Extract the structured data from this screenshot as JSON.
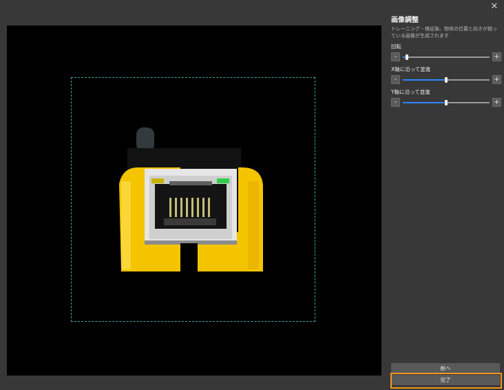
{
  "dialog": {
    "close_symbol": "✕",
    "close_icon": "close-icon"
  },
  "panel": {
    "title": "画像調整",
    "description": "トレーニング・検証後、物体の位置と向きが揃っている画像が生成されます"
  },
  "controls": [
    {
      "label": "回転",
      "minus": "-",
      "plus": "+",
      "value_fraction": 0.05,
      "accent": "#2f87ff"
    },
    {
      "label": "X軸に沿って並進",
      "minus": "-",
      "plus": "+",
      "value_fraction": 0.5,
      "accent": "#2f87ff"
    },
    {
      "label": "Y軸に沿って並進",
      "minus": "-",
      "plus": "+",
      "value_fraction": 0.5,
      "accent": "#2f87ff"
    }
  ],
  "buttons": {
    "prev": "前へ",
    "done": "完了"
  },
  "colors": {
    "background": "#383838",
    "viewport": "#000000",
    "roi_border": "#3aa9a9",
    "highlight": "#f39a1b",
    "accent": "#2f87ff",
    "object_yellow": "#f5c400"
  }
}
